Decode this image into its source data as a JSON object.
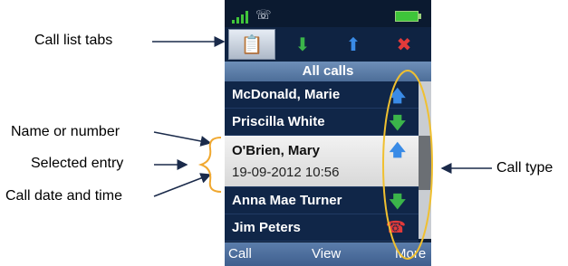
{
  "callouts": {
    "call_list_tabs": "Call list tabs",
    "name_or_number": "Name or number",
    "selected_entry": "Selected entry",
    "call_date_time": "Call date and time",
    "call_type": "Call type"
  },
  "status": {
    "signal_icon": "signal-strength-icon",
    "call_icon_glyph": "☏",
    "battery_icon": "battery-full-icon"
  },
  "tabs": [
    {
      "icon": "all-calls-list-icon",
      "glyph": "📋",
      "active": true
    },
    {
      "icon": "incoming-calls-icon",
      "glyph": "⬇",
      "active": false
    },
    {
      "icon": "outgoing-calls-icon",
      "glyph": "⬆",
      "active": false
    },
    {
      "icon": "missed-calls-icon",
      "glyph": "✖",
      "active": false
    }
  ],
  "list_title": "All calls",
  "entries": [
    {
      "name": "McDonald, Marie",
      "type": "outgoing",
      "type_glyph": "🡅"
    },
    {
      "name": "Priscilla White",
      "type": "incoming",
      "type_glyph": "🡇"
    },
    {
      "name": "O'Brien, Mary",
      "datetime": "19-09-2012 10:56",
      "type": "outgoing",
      "type_glyph": "🡅",
      "selected": true
    },
    {
      "name": "Anna Mae Turner",
      "type": "incoming",
      "type_glyph": "🡇"
    },
    {
      "name": "Jim Peters",
      "type": "missed",
      "type_glyph": "☎"
    }
  ],
  "softkeys": {
    "left": "Call",
    "middle": "View",
    "right": "More"
  },
  "colors": {
    "screen_bg": "#0e1e36",
    "selected_bg": "#e6e6e6",
    "callout_ellipse": "#f0a830",
    "incoming": "#3bb54a",
    "outgoing": "#3a8be6",
    "missed": "#e23a3a"
  }
}
